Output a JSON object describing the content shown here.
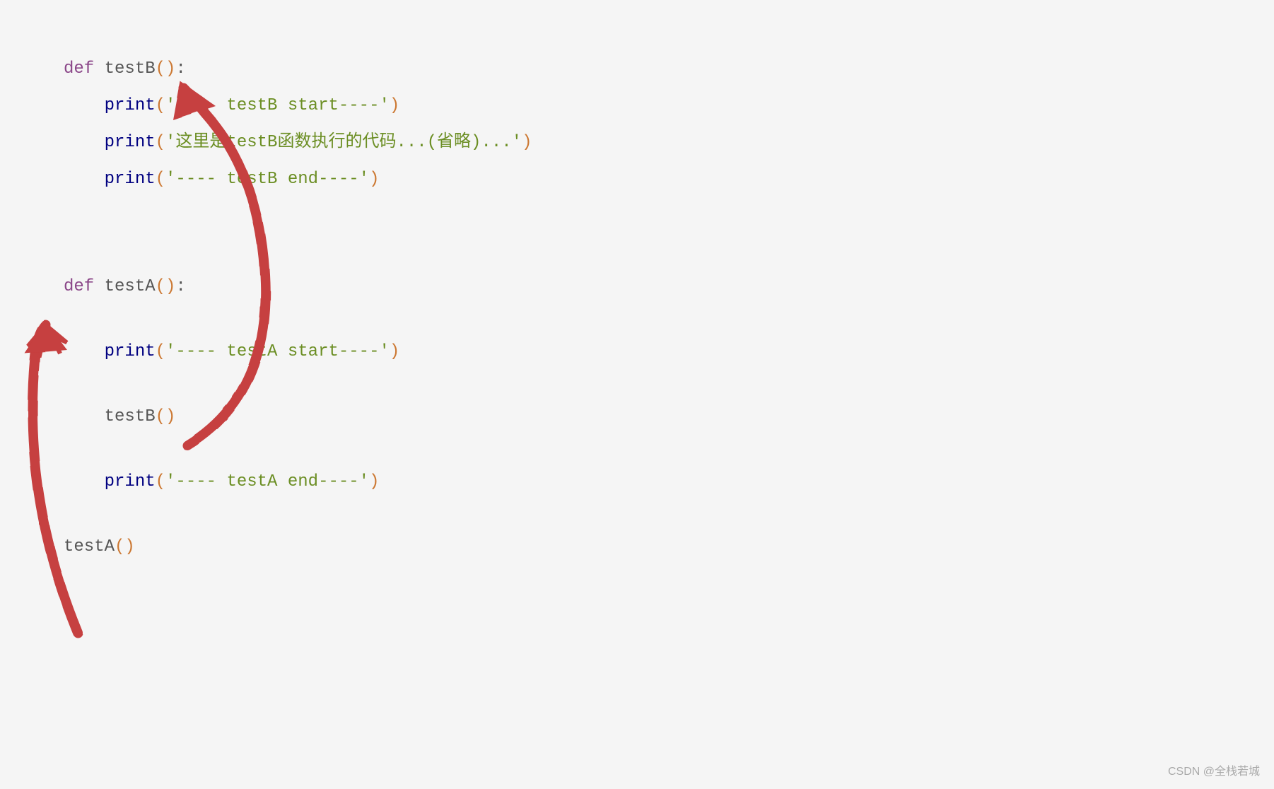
{
  "code": {
    "line1": {
      "keyword": "def",
      "funcname": " testB",
      "parens": "()",
      "colon": ":"
    },
    "line2": {
      "indent": "    ",
      "builtin": "print",
      "paren_open": "(",
      "string": "'---- testB start----'",
      "paren_close": ")"
    },
    "line3": {
      "indent": "    ",
      "builtin": "print",
      "paren_open": "(",
      "string": "'这里是testB函数执行的代码...(省略)...'",
      "paren_close": ")"
    },
    "line4": {
      "indent": "    ",
      "builtin": "print",
      "paren_open": "(",
      "string": "'---- testB end----'",
      "paren_close": ")"
    },
    "line5": {
      "keyword": "def",
      "funcname": " testA",
      "parens": "()",
      "colon": ":"
    },
    "line6": {
      "indent": "    ",
      "builtin": "print",
      "paren_open": "(",
      "string": "'---- testA start----'",
      "paren_close": ")"
    },
    "line7": {
      "indent": "    ",
      "call": "testB",
      "parens": "()"
    },
    "line8": {
      "indent": "    ",
      "builtin": "print",
      "paren_open": "(",
      "string": "'---- testA end----'",
      "paren_close": ")"
    },
    "line9": {
      "call": "testA",
      "parens": "()"
    }
  },
  "watermark": "CSDN @全栈若城"
}
